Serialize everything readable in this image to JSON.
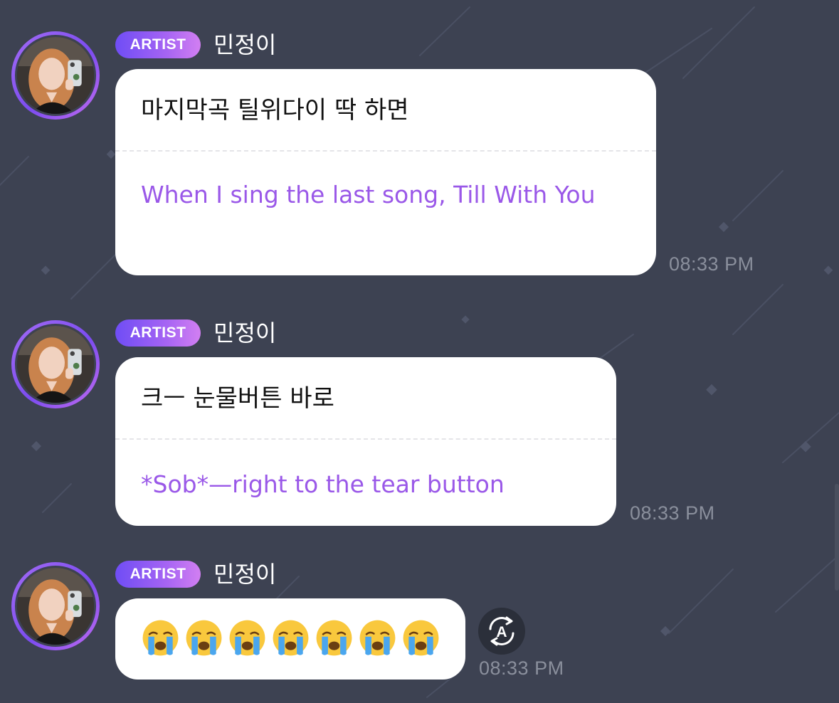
{
  "messages": [
    {
      "badge": "ARTIST",
      "sender": "민정이",
      "text_ko": "마지막곡 틸위다이 딱 하면",
      "text_en": "When I sing the last song, Till With You",
      "time": "08:33 PM"
    },
    {
      "badge": "ARTIST",
      "sender": "민정이",
      "text_ko": "크ㅡ 눈물버튼 바로",
      "text_en": "*Sob*—right to the tear button",
      "time": "08:33 PM"
    },
    {
      "badge": "ARTIST",
      "sender": "민정이",
      "emojis": [
        "😭",
        "😭",
        "😭",
        "😭",
        "😭",
        "😭",
        "😭"
      ],
      "time": "08:33 PM",
      "translate_icon": "auto-translate-icon"
    }
  ],
  "colors": {
    "background": "#3d4252",
    "bubble": "#ffffff",
    "translation_text": "#9a58e8",
    "badge_gradient_start": "#6f4df5",
    "badge_gradient_end": "#d27ff2",
    "timestamp": "#8a8f9c"
  }
}
